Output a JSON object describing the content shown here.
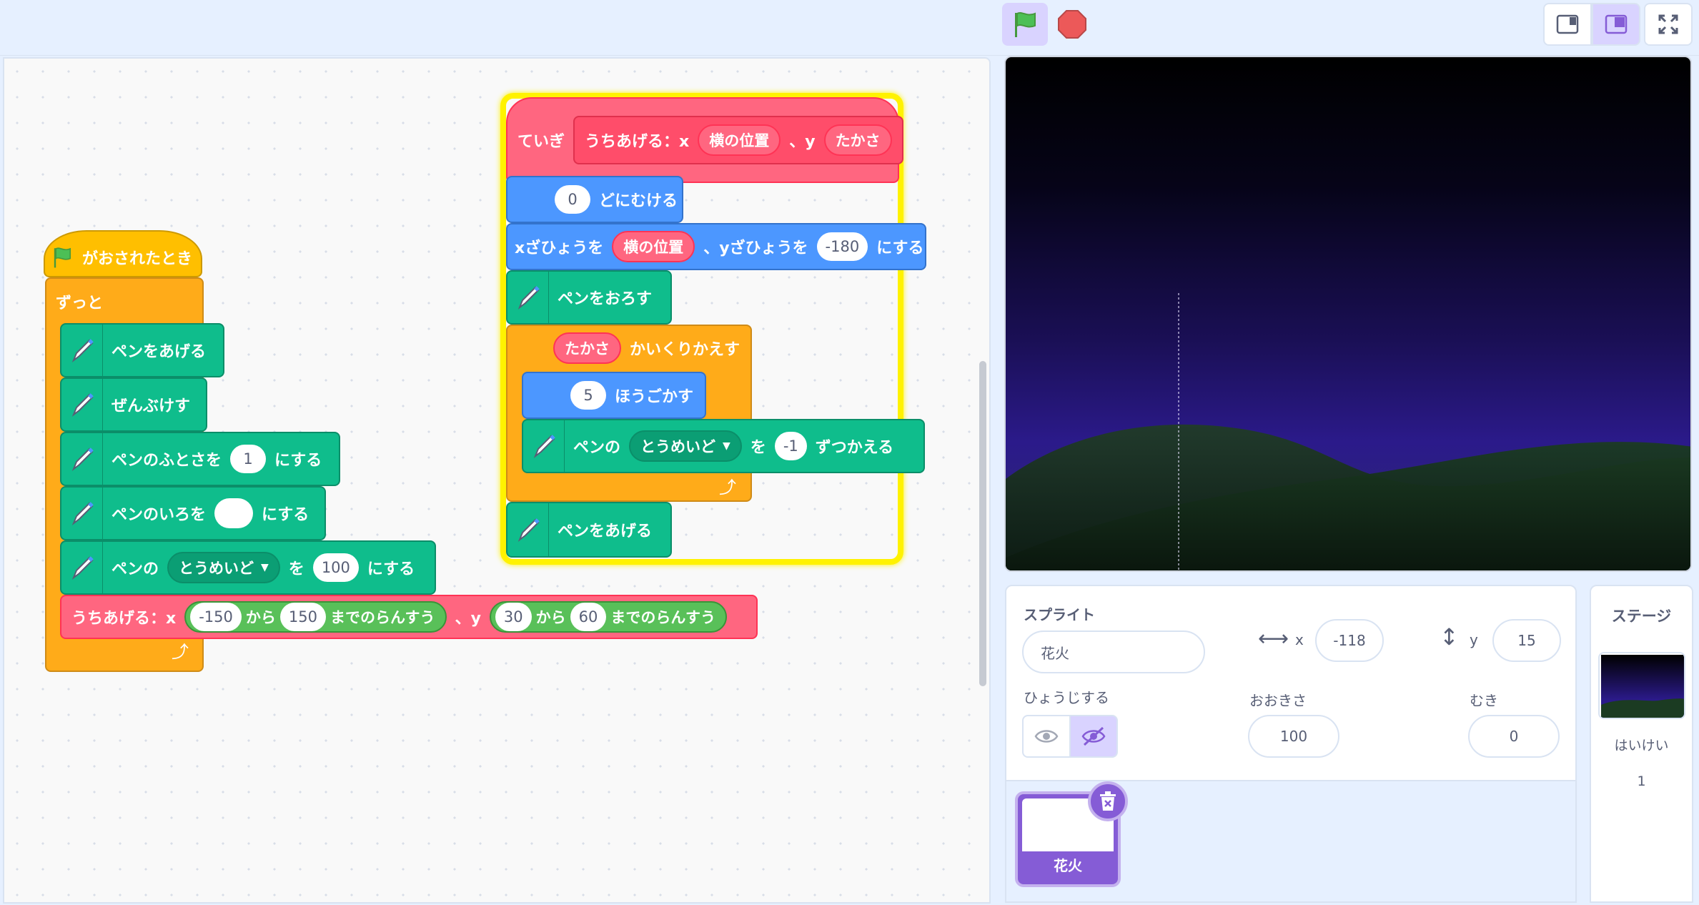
{
  "blocks_left": {
    "hat": "がおされたとき",
    "forever": "ずっと",
    "pen_up": "ペンをあげる",
    "clear": "ぜんぶけす",
    "size_pre": "ペンのふとさを",
    "size_val": "1",
    "size_post": "にする",
    "color_pre": "ペンのいろを",
    "color_post": "にする",
    "param_pre": "ペンの",
    "param_drop": "とうめいど",
    "param_mid": "を",
    "param_val": "100",
    "param_post": "にする",
    "call_label": "うちあげる：x",
    "rand1_from": "-150",
    "rand_kara": "から",
    "rand1_to": "150",
    "rand_made": "までのらんすう",
    "call_y": "、y",
    "rand2_from": "30",
    "rand2_to": "60"
  },
  "blocks_right": {
    "define": "ていぎ",
    "proto_name": "うちあげる：x",
    "arg_x": "横の位置",
    "proto_y": "、y",
    "arg_y": "たかさ",
    "point_val": "0",
    "point_label": "どにむける",
    "goto_x_label": "xざひょうを",
    "goto_x_arg": "横の位置",
    "goto_y_label": "、yざひょうを",
    "goto_y_val": "-180",
    "goto_post": "にする",
    "pen_down": "ペンをおろす",
    "repeat_arg": "たかさ",
    "repeat_label": "かいくりかえす",
    "move_val": "5",
    "move_label": "ほうごかす",
    "change_pre": "ペンの",
    "change_drop": "とうめいど",
    "change_mid": "を",
    "change_val": "-1",
    "change_post": "ずつかえる",
    "pen_up": "ペンをあげる"
  },
  "sprite_info": {
    "sprite_label": "スプライト",
    "sprite_name": "花火",
    "x_label": "x",
    "x_value": "-118",
    "y_label": "y",
    "y_value": "15",
    "show_label": "ひょうじする",
    "size_label": "おおきさ",
    "size_value": "100",
    "direction_label": "むき",
    "direction_value": "0"
  },
  "sprite_list": {
    "sprite_name": "花火"
  },
  "stage_pane": {
    "title": "ステージ",
    "backdrops_label": "はいけい",
    "backdrops_count": "1"
  },
  "colors": {
    "events": "#ffbf00",
    "control": "#ffab19",
    "motion": "#4c97ff",
    "pen": "#0fbd8c",
    "custom": "#ff6680",
    "operators": "#59c059",
    "highlight": "#fff200"
  }
}
